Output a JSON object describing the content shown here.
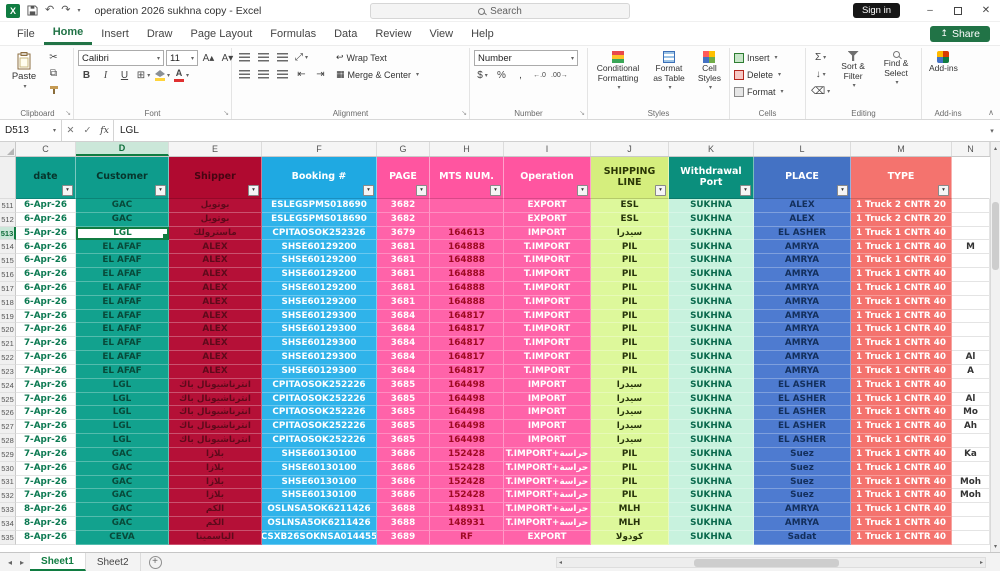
{
  "titlebar": {
    "title": "operation 2026 sukhna copy  -  Excel",
    "search_placeholder": "Search",
    "sign_in_label": "Sign in"
  },
  "menubar": {
    "tabs": [
      "File",
      "Home",
      "Insert",
      "Draw",
      "Page Layout",
      "Formulas",
      "Data",
      "Review",
      "View",
      "Help"
    ],
    "active": "Home",
    "share_label": "Share"
  },
  "ribbon": {
    "groups": {
      "clipboard": {
        "label": "Clipboard",
        "paste_label": "Paste"
      },
      "font": {
        "label": "Font",
        "font_name": "Calibri",
        "font_size": "11",
        "bold_label": "B",
        "italic_label": "I",
        "underline_label": "U"
      },
      "alignment": {
        "label": "Alignment",
        "wrap_text_label": "Wrap Text",
        "merge_center_label": "Merge & Center"
      },
      "number": {
        "label": "Number",
        "format_selected": "Number"
      },
      "styles": {
        "label": "Styles",
        "conditional_formatting_label": "Conditional Formatting",
        "format_as_table_label": "Format as Table",
        "cell_styles_label": "Cell Styles"
      },
      "cells": {
        "label": "Cells",
        "insert_label": "Insert",
        "delete_label": "Delete",
        "format_label": "Format"
      },
      "editing": {
        "label": "Editing",
        "sort_filter_label": "Sort & Filter",
        "find_select_label": "Find & Select"
      },
      "addins": {
        "label": "Add-ins"
      }
    }
  },
  "formula_bar": {
    "name_box": "D513",
    "fx_label": "fx",
    "content": "LGL"
  },
  "colors": {
    "accent_green": "#217346",
    "selection_green": "#107C41",
    "sign_in_bg": "#161616"
  },
  "sheet": {
    "selected": {
      "row": "513",
      "col": "D"
    },
    "columns": [
      {
        "key": "c",
        "letter": "C",
        "label": "date",
        "head_bg": "#0E9C8C",
        "head_fg": "#06352C",
        "bg": "#FFFFFF",
        "fg": "#0C7A52",
        "plain": true,
        "filter": true
      },
      {
        "key": "d",
        "letter": "D",
        "label": "Customer",
        "head_bg": "#0E9C8C",
        "head_fg": "#06352C",
        "bg": "#12A28E",
        "fg": "#084A3A",
        "filter": true
      },
      {
        "key": "e",
        "letter": "E",
        "label": "Shipper",
        "head_bg": "#B00A30",
        "head_fg": "#460512",
        "bg": "#B51037",
        "fg": "#5E0A1B",
        "filter": true
      },
      {
        "key": "f",
        "letter": "F",
        "label": "Booking #",
        "head_bg": "#1FA9E2",
        "head_fg": "#FFFFFF",
        "bg": "#2FB3EA",
        "fg": "#FFFFFF",
        "filter": true
      },
      {
        "key": "g",
        "letter": "G",
        "label": "PAGE",
        "head_bg": "#FF55A0",
        "head_fg": "#FFFFFF",
        "bg": "#FF63A9",
        "fg": "#FFFFFF",
        "filter": true
      },
      {
        "key": "h",
        "letter": "H",
        "label": "MTS NUM.",
        "head_bg": "#FF55A0",
        "head_fg": "#FFFFFF",
        "bg": "#FF63A9",
        "fg": "#9E0A22",
        "filter": true
      },
      {
        "key": "i",
        "letter": "I",
        "label": "Operation",
        "head_bg": "#FF55A0",
        "head_fg": "#FFFFFF",
        "bg": "#FF63A9",
        "fg": "#FFFFFF",
        "filter": true
      },
      {
        "key": "j",
        "letter": "J",
        "label": "SHIPPING LINE",
        "head_bg": "#D5EE7D",
        "head_fg": "#2B3705",
        "bg": "#DDF89B",
        "fg": "#26330A",
        "filter": true
      },
      {
        "key": "k",
        "letter": "K",
        "label": "Withdrawal Port",
        "head_bg": "#0B8F7D",
        "head_fg": "#FFFFFF",
        "bg": "#C8F2DE",
        "fg": "#09684C",
        "filter": true
      },
      {
        "key": "l",
        "letter": "L",
        "label": "PLACE",
        "head_bg": "#4472C4",
        "head_fg": "#FFFFFF",
        "bg": "#4E7BD0",
        "fg": "#132F5C",
        "filter": true
      },
      {
        "key": "m",
        "letter": "M",
        "label": "TYPE",
        "head_bg": "#F4736E",
        "head_fg": "#FFFFFF",
        "bg": "#F4736E",
        "fg": "#FFFFFF",
        "filter": true
      },
      {
        "key": "x",
        "letter": "N",
        "label": "",
        "head_bg": "#FFFFFF",
        "head_fg": "#333333",
        "bg": "#FFFFFF",
        "fg": "#333333",
        "plain": true,
        "filter": false
      }
    ],
    "rows": [
      {
        "n": "511",
        "c": "6-Apr-26",
        "d": "GAC",
        "e": "بوتويل",
        "f": "ESLEGSPMS018690",
        "g": "3682",
        "h": "",
        "i": "EXPORT",
        "j": "ESL",
        "k": "SUKHNA",
        "l": "ALEX",
        "m": "1 Truck 2 CNTR 20",
        "x": ""
      },
      {
        "n": "512",
        "c": "6-Apr-26",
        "d": "GAC",
        "e": "بوتويل",
        "f": "ESLEGSPMS018690",
        "g": "3682",
        "h": "",
        "i": "EXPORT",
        "j": "ESL",
        "k": "SUKHNA",
        "l": "ALEX",
        "m": "1 Truck 2 CNTR 20",
        "x": ""
      },
      {
        "n": "513",
        "c": "5-Apr-26",
        "d": "LGL",
        "e": "ماسترولك",
        "f": "CPITAOSOK252326",
        "g": "3679",
        "h": "164613",
        "i": "IMPORT",
        "j": "سيدرا",
        "k": "SUKHNA",
        "l": "EL ASHER",
        "m": "1 Truck 1 CNTR 40",
        "x": ""
      },
      {
        "n": "514",
        "c": "6-Apr-26",
        "d": "EL AFAF",
        "e": "ALEX",
        "f": "SHSE60129200",
        "g": "3681",
        "h": "164888",
        "i": "T.IMPORT",
        "j": "PIL",
        "k": "SUKHNA",
        "l": "AMRYA",
        "m": "1 Truck 1 CNTR 40",
        "x": "M"
      },
      {
        "n": "515",
        "c": "6-Apr-26",
        "d": "EL AFAF",
        "e": "ALEX",
        "f": "SHSE60129200",
        "g": "3681",
        "h": "164888",
        "i": "T.IMPORT",
        "j": "PIL",
        "k": "SUKHNA",
        "l": "AMRYA",
        "m": "1 Truck 1 CNTR 40",
        "x": ""
      },
      {
        "n": "516",
        "c": "6-Apr-26",
        "d": "EL AFAF",
        "e": "ALEX",
        "f": "SHSE60129200",
        "g": "3681",
        "h": "164888",
        "i": "T.IMPORT",
        "j": "PIL",
        "k": "SUKHNA",
        "l": "AMRYA",
        "m": "1 Truck 1 CNTR 40",
        "x": ""
      },
      {
        "n": "517",
        "c": "6-Apr-26",
        "d": "EL AFAF",
        "e": "ALEX",
        "f": "SHSE60129200",
        "g": "3681",
        "h": "164888",
        "i": "T.IMPORT",
        "j": "PIL",
        "k": "SUKHNA",
        "l": "AMRYA",
        "m": "1 Truck 1 CNTR 40",
        "x": ""
      },
      {
        "n": "518",
        "c": "6-Apr-26",
        "d": "EL AFAF",
        "e": "ALEX",
        "f": "SHSE60129200",
        "g": "3681",
        "h": "164888",
        "i": "T.IMPORT",
        "j": "PIL",
        "k": "SUKHNA",
        "l": "AMRYA",
        "m": "1 Truck 1 CNTR 40",
        "x": ""
      },
      {
        "n": "519",
        "c": "7-Apr-26",
        "d": "EL AFAF",
        "e": "ALEX",
        "f": "SHSE60129300",
        "g": "3684",
        "h": "164817",
        "i": "T.IMPORT",
        "j": "PIL",
        "k": "SUKHNA",
        "l": "AMRYA",
        "m": "1 Truck 1 CNTR 40",
        "x": ""
      },
      {
        "n": "520",
        "c": "7-Apr-26",
        "d": "EL AFAF",
        "e": "ALEX",
        "f": "SHSE60129300",
        "g": "3684",
        "h": "164817",
        "i": "T.IMPORT",
        "j": "PIL",
        "k": "SUKHNA",
        "l": "AMRYA",
        "m": "1 Truck 1 CNTR 40",
        "x": ""
      },
      {
        "n": "521",
        "c": "7-Apr-26",
        "d": "EL AFAF",
        "e": "ALEX",
        "f": "SHSE60129300",
        "g": "3684",
        "h": "164817",
        "i": "T.IMPORT",
        "j": "PIL",
        "k": "SUKHNA",
        "l": "AMRYA",
        "m": "1 Truck 1 CNTR 40",
        "x": ""
      },
      {
        "n": "522",
        "c": "7-Apr-26",
        "d": "EL AFAF",
        "e": "ALEX",
        "f": "SHSE60129300",
        "g": "3684",
        "h": "164817",
        "i": "T.IMPORT",
        "j": "PIL",
        "k": "SUKHNA",
        "l": "AMRYA",
        "m": "1 Truck 1 CNTR 40",
        "x": "Al"
      },
      {
        "n": "523",
        "c": "7-Apr-26",
        "d": "EL AFAF",
        "e": "ALEX",
        "f": "SHSE60129300",
        "g": "3684",
        "h": "164817",
        "i": "T.IMPORT",
        "j": "PIL",
        "k": "SUKHNA",
        "l": "AMRYA",
        "m": "1 Truck 1 CNTR 40",
        "x": "A"
      },
      {
        "n": "524",
        "c": "7-Apr-26",
        "d": "LGL",
        "e": "انترناشيونال باك",
        "f": "CPITAOSOK252226",
        "g": "3685",
        "h": "164498",
        "i": "IMPORT",
        "j": "سيدرا",
        "k": "SUKHNA",
        "l": "EL ASHER",
        "m": "1 Truck 1 CNTR 40",
        "x": ""
      },
      {
        "n": "525",
        "c": "7-Apr-26",
        "d": "LGL",
        "e": "انترناشيونال باك",
        "f": "CPITAOSOK252226",
        "g": "3685",
        "h": "164498",
        "i": "IMPORT",
        "j": "سيدرا",
        "k": "SUKHNA",
        "l": "EL ASHER",
        "m": "1 Truck 1 CNTR 40",
        "x": "Al"
      },
      {
        "n": "526",
        "c": "7-Apr-26",
        "d": "LGL",
        "e": "انترناشيونال باك",
        "f": "CPITAOSOK252226",
        "g": "3685",
        "h": "164498",
        "i": "IMPORT",
        "j": "سيدرا",
        "k": "SUKHNA",
        "l": "EL ASHER",
        "m": "1 Truck 1 CNTR 40",
        "x": "Mo"
      },
      {
        "n": "527",
        "c": "7-Apr-26",
        "d": "LGL",
        "e": "انترناشيونال باك",
        "f": "CPITAOSOK252226",
        "g": "3685",
        "h": "164498",
        "i": "IMPORT",
        "j": "سيدرا",
        "k": "SUKHNA",
        "l": "EL ASHER",
        "m": "1 Truck 1 CNTR 40",
        "x": "Ah"
      },
      {
        "n": "528",
        "c": "7-Apr-26",
        "d": "LGL",
        "e": "انترناشيونال باك",
        "f": "CPITAOSOK252226",
        "g": "3685",
        "h": "164498",
        "i": "IMPORT",
        "j": "سيدرا",
        "k": "SUKHNA",
        "l": "EL ASHER",
        "m": "1 Truck 1 CNTR 40",
        "x": ""
      },
      {
        "n": "529",
        "c": "7-Apr-26",
        "d": "GAC",
        "e": "بلازا",
        "f": "SHSE60130100",
        "g": "3686",
        "h": "152428",
        "i": "T.IMPORT+حراسة",
        "j": "PIL",
        "k": "SUKHNA",
        "l": "Suez",
        "m": "1 Truck 1 CNTR 40",
        "x": "Ka"
      },
      {
        "n": "530",
        "c": "7-Apr-26",
        "d": "GAC",
        "e": "بلازا",
        "f": "SHSE60130100",
        "g": "3686",
        "h": "152428",
        "i": "T.IMPORT+حراسة",
        "j": "PIL",
        "k": "SUKHNA",
        "l": "Suez",
        "m": "1 Truck 1 CNTR 40",
        "x": ""
      },
      {
        "n": "531",
        "c": "7-Apr-26",
        "d": "GAC",
        "e": "بلازا",
        "f": "SHSE60130100",
        "g": "3686",
        "h": "152428",
        "i": "T.IMPORT+حراسة",
        "j": "PIL",
        "k": "SUKHNA",
        "l": "Suez",
        "m": "1 Truck 1 CNTR 40",
        "x": "Moh"
      },
      {
        "n": "532",
        "c": "7-Apr-26",
        "d": "GAC",
        "e": "بلازا",
        "f": "SHSE60130100",
        "g": "3686",
        "h": "152428",
        "i": "T.IMPORT+حراسة",
        "j": "PIL",
        "k": "SUKHNA",
        "l": "Suez",
        "m": "1 Truck 1 CNTR 40",
        "x": "Moh"
      },
      {
        "n": "533",
        "c": "8-Apr-26",
        "d": "GAC",
        "e": "الكم",
        "f": "OSLNSA5OK6211426",
        "g": "3688",
        "h": "148931",
        "i": "T.IMPORT+حراسة",
        "j": "MLH",
        "k": "SUKHNA",
        "l": "AMRYA",
        "m": "1 Truck 1 CNTR 40",
        "x": ""
      },
      {
        "n": "534",
        "c": "8-Apr-26",
        "d": "GAC",
        "e": "الكم",
        "f": "OSLNSA5OK6211426",
        "g": "3688",
        "h": "148931",
        "i": "T.IMPORT+حراسة",
        "j": "MLH",
        "k": "SUKHNA",
        "l": "AMRYA",
        "m": "1 Truck 1 CNTR 40",
        "x": ""
      },
      {
        "n": "535",
        "c": "8-Apr-26",
        "d": "CEVA",
        "e": "الياسمينا",
        "f": "CSXB26SOKNSA014455",
        "g": "3689",
        "h": "RF",
        "i": "EXPORT",
        "j": "كودولا",
        "k": "SUKHNA",
        "l": "Sadat",
        "m": "1 Truck 1 CNTR 40",
        "x": ""
      }
    ]
  },
  "tabbar": {
    "sheets": [
      "Sheet1",
      "Sheet2"
    ],
    "active": "Sheet1"
  }
}
